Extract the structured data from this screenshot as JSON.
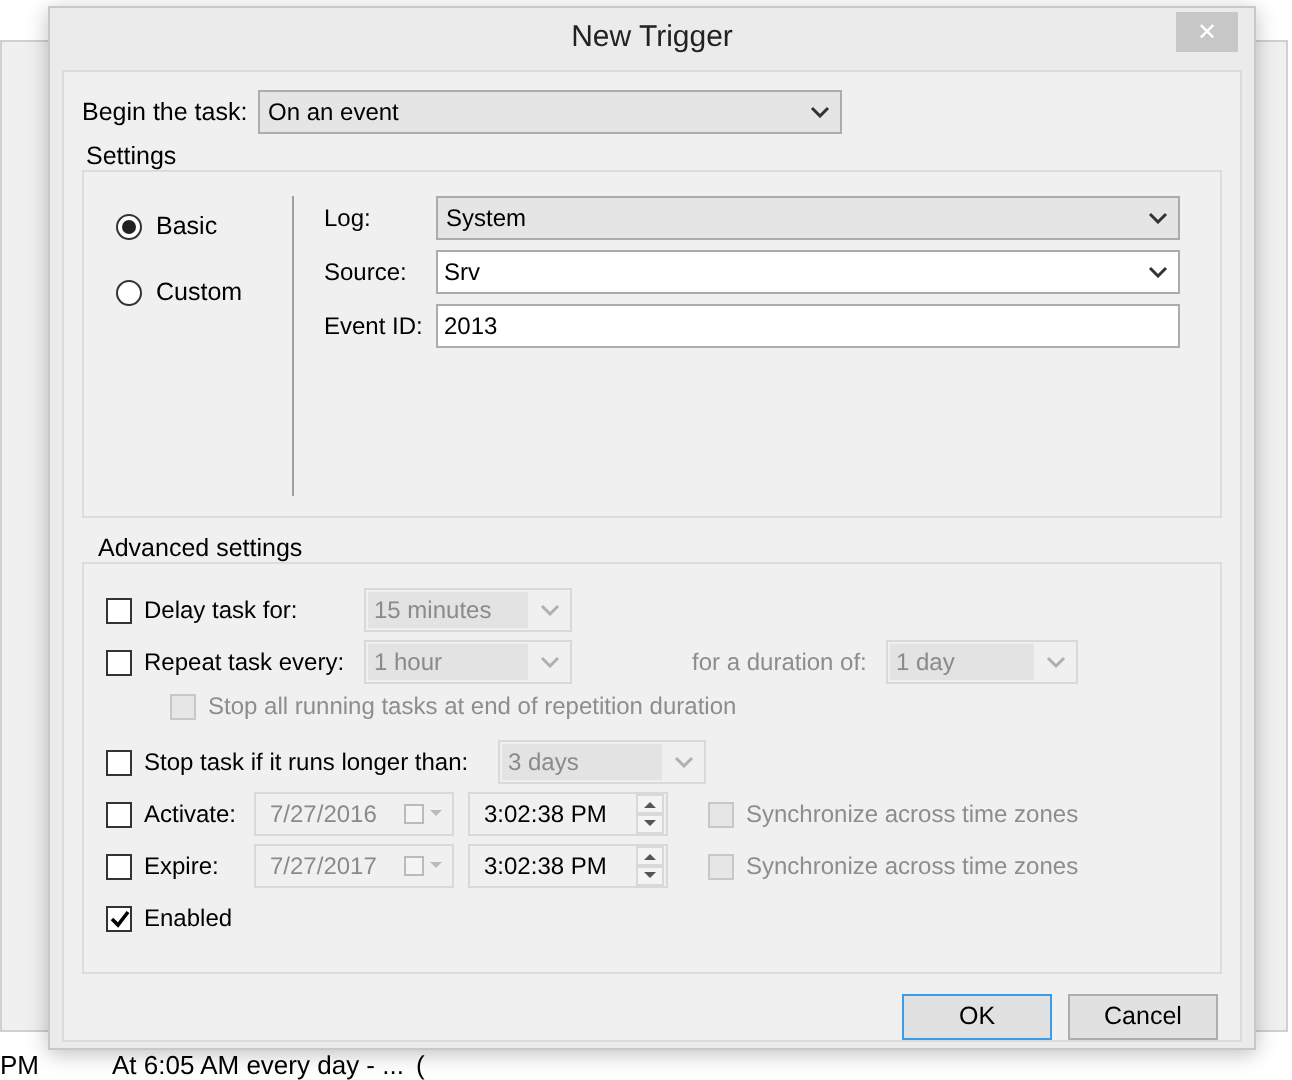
{
  "background": {
    "row": [
      "PM",
      "At 6:05 AM every day - ...",
      "("
    ]
  },
  "window": {
    "title": "New Trigger",
    "close": "✕"
  },
  "begin_task": {
    "label": "Begin the task:",
    "value": "On an event"
  },
  "settings": {
    "title": "Settings",
    "modes": [
      {
        "label": "Basic",
        "selected": true
      },
      {
        "label": "Custom",
        "selected": false
      }
    ],
    "fields": [
      {
        "kind": "dropdown",
        "label": "Log:",
        "value": "System",
        "disabled": false
      },
      {
        "kind": "combo",
        "label": "Source:",
        "value": "Srv"
      },
      {
        "kind": "text",
        "label": "Event ID:",
        "value": "2013"
      }
    ]
  },
  "advanced": {
    "title": "Advanced settings",
    "delay": {
      "label": "Delay task for:",
      "checked": false,
      "value": "15 minutes",
      "disabled": true
    },
    "repeat": {
      "label": "Repeat task every:",
      "checked": false,
      "value": "1 hour",
      "disabled": true,
      "duration_label": "for a duration of:",
      "duration_value": "1 day"
    },
    "stop_all": {
      "label": "Stop all running tasks at end of repetition duration",
      "checked": false,
      "disabled": true
    },
    "stop_long": {
      "label": "Stop task if it runs longer than:",
      "checked": false,
      "value": "3 days",
      "disabled": true
    },
    "schedule": [
      {
        "label": "Activate:",
        "checked": false,
        "date": "7/27/2016",
        "time": "3:02:38 PM",
        "sync_label": "Synchronize across time zones",
        "sync_checked": false,
        "disabled": true
      },
      {
        "label": "Expire:",
        "checked": false,
        "date": "7/27/2017",
        "time": "3:02:38 PM",
        "sync_label": "Synchronize across time zones",
        "sync_checked": false,
        "disabled": true
      }
    ],
    "enabled": {
      "label": "Enabled",
      "checked": true
    }
  },
  "buttons": [
    {
      "label": "OK",
      "default": true
    },
    {
      "label": "Cancel",
      "default": false
    }
  ]
}
